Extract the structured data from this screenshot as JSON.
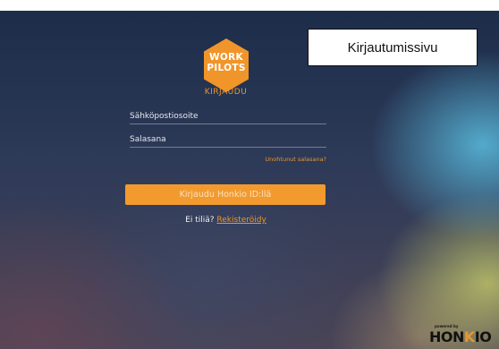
{
  "logo": {
    "line1": "WORK",
    "line2": "PILOTS"
  },
  "login": {
    "heading": "KIRJAUDU",
    "email_placeholder": "Sähköpostiosoite",
    "password_placeholder": "Salasana",
    "forgot_password": "Unohtunut salasana?",
    "submit_label": "Kirjaudu Honkio ID:llä"
  },
  "register": {
    "prompt": "Ei tiliä?",
    "link": "Rekisteröidy"
  },
  "page_title": "Kirjautumissivu",
  "branding": {
    "powered_by": "powered by",
    "name_a": "HON",
    "name_b": "K",
    "name_c": "IO"
  },
  "colors": {
    "accent": "#f29a2e",
    "background": "#1c2d4a",
    "logo": "#f0952a"
  }
}
